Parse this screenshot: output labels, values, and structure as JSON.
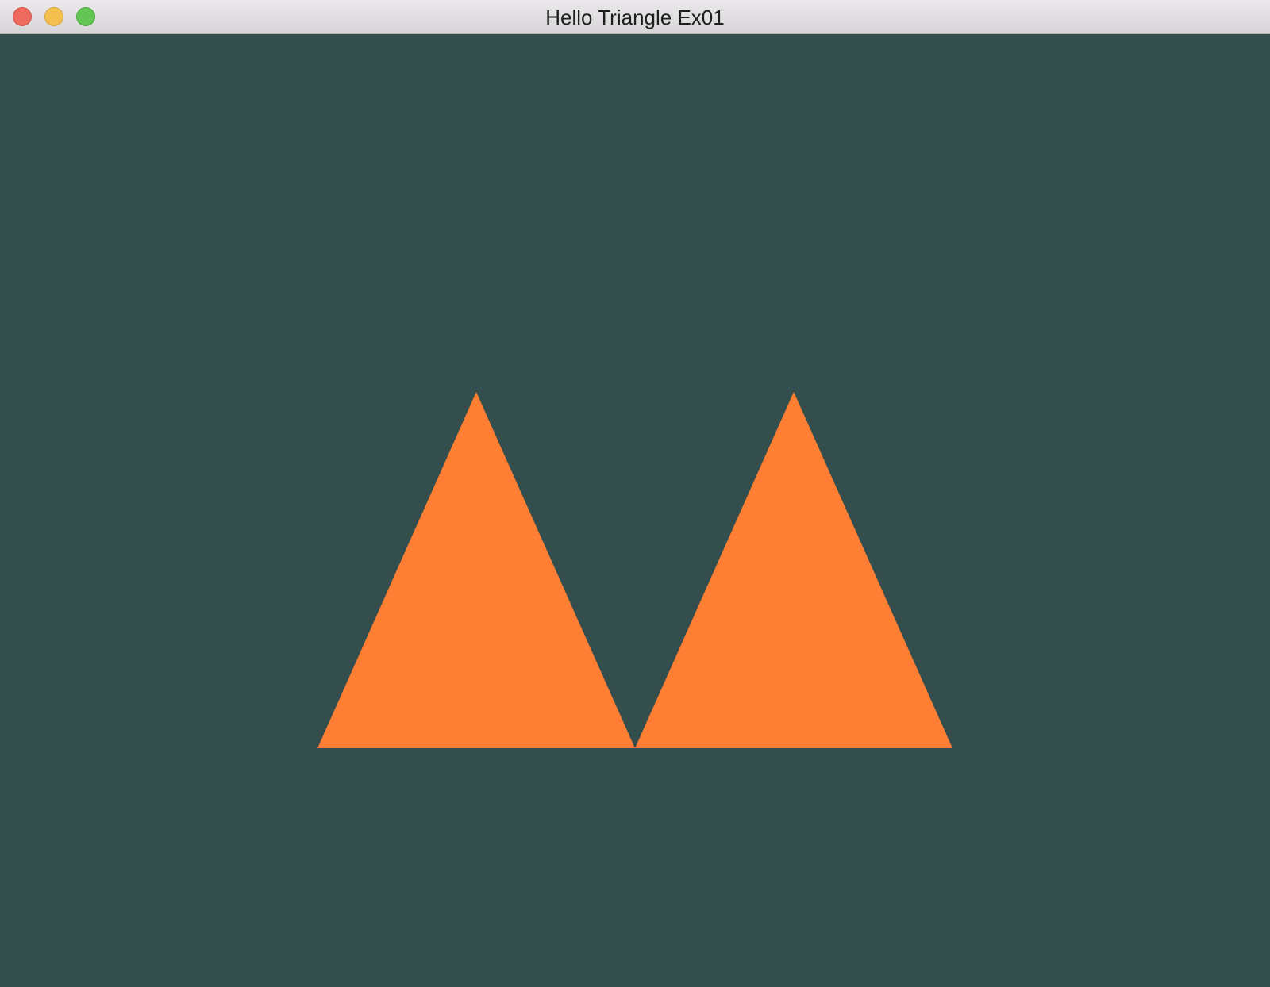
{
  "window": {
    "title": "Hello Triangle Ex01",
    "traffic_lights": [
      {
        "name": "close",
        "color": "#ed6a5e",
        "border": "#d25147"
      },
      {
        "name": "minimize",
        "color": "#f5bf4f",
        "border": "#d9a33a"
      },
      {
        "name": "zoom",
        "color": "#62c554",
        "border": "#4ea942"
      }
    ]
  },
  "scene": {
    "clear_color": "#344e4e",
    "triangle_color": "#fe7f33"
  }
}
